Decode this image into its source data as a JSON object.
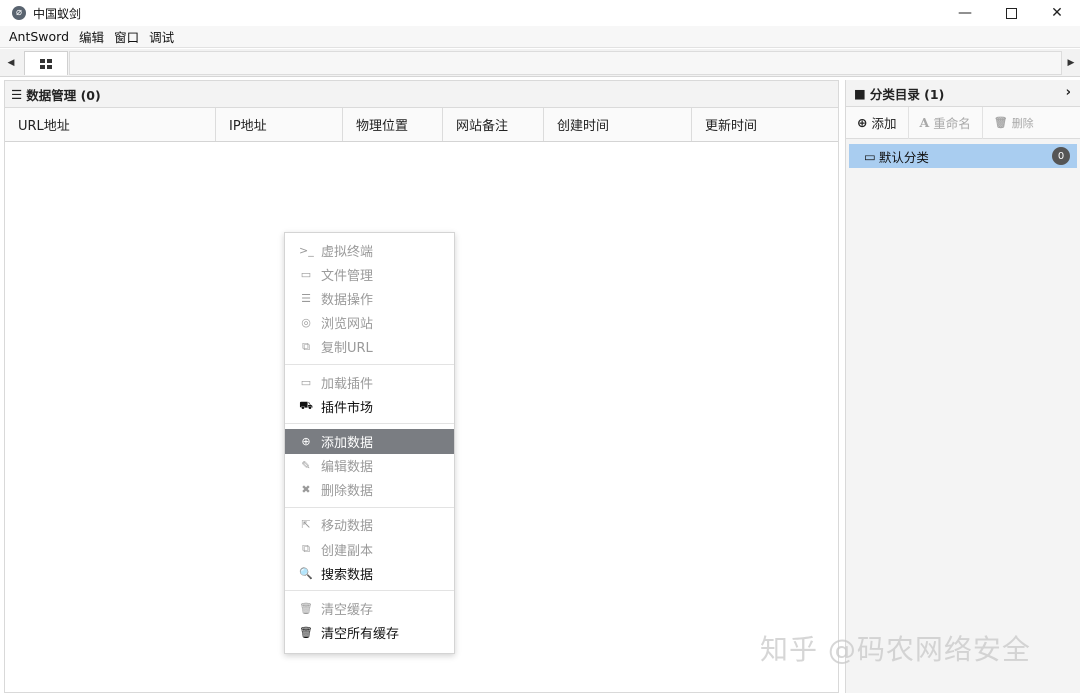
{
  "window": {
    "title": "中国蚁剑",
    "minimize": "—",
    "close": "✕"
  },
  "menubar": {
    "items": [
      "AntSword",
      "编辑",
      "窗口",
      "调试"
    ]
  },
  "tabbar": {
    "left_arrow": "◀",
    "right_arrow": "▶"
  },
  "data_panel": {
    "title": "数据管理 (0)",
    "columns": [
      "URL地址",
      "IP地址",
      "物理位置",
      "网站备注",
      "创建时间",
      "更新时间"
    ]
  },
  "context_menu": {
    "groups": [
      [
        {
          "icon": ">_",
          "label": "虚拟终端",
          "enabled": false
        },
        {
          "icon": "▭",
          "label": "文件管理",
          "enabled": false
        },
        {
          "icon": "☰",
          "label": "数据操作",
          "enabled": false
        },
        {
          "icon": "◎",
          "label": "浏览网站",
          "enabled": false
        },
        {
          "icon": "⧉",
          "label": "复制URL",
          "enabled": false
        }
      ],
      [
        {
          "icon": "▭",
          "label": "加载插件",
          "enabled": false
        },
        {
          "icon": "⛟",
          "label": "插件市场",
          "enabled": true
        }
      ],
      [
        {
          "icon": "⊕",
          "label": "添加数据",
          "enabled": true,
          "active": true
        },
        {
          "icon": "✎",
          "label": "编辑数据",
          "enabled": false
        },
        {
          "icon": "✖",
          "label": "删除数据",
          "enabled": false
        }
      ],
      [
        {
          "icon": "⇱",
          "label": "移动数据",
          "enabled": false
        },
        {
          "icon": "⧉",
          "label": "创建副本",
          "enabled": false
        },
        {
          "icon": "🔍",
          "label": "搜索数据",
          "enabled": true
        }
      ],
      [
        {
          "icon": "🗑",
          "label": "清空缓存",
          "enabled": false
        },
        {
          "icon": "🗑",
          "label": "清空所有缓存",
          "enabled": true
        }
      ]
    ]
  },
  "category_panel": {
    "title": "分类目录 (1)",
    "toolbar": {
      "add": "添加",
      "rename": "重命名",
      "delete": "删除"
    },
    "items": [
      {
        "label": "默认分类",
        "count": "0"
      }
    ]
  },
  "watermark": "知乎 @码农网络安全"
}
